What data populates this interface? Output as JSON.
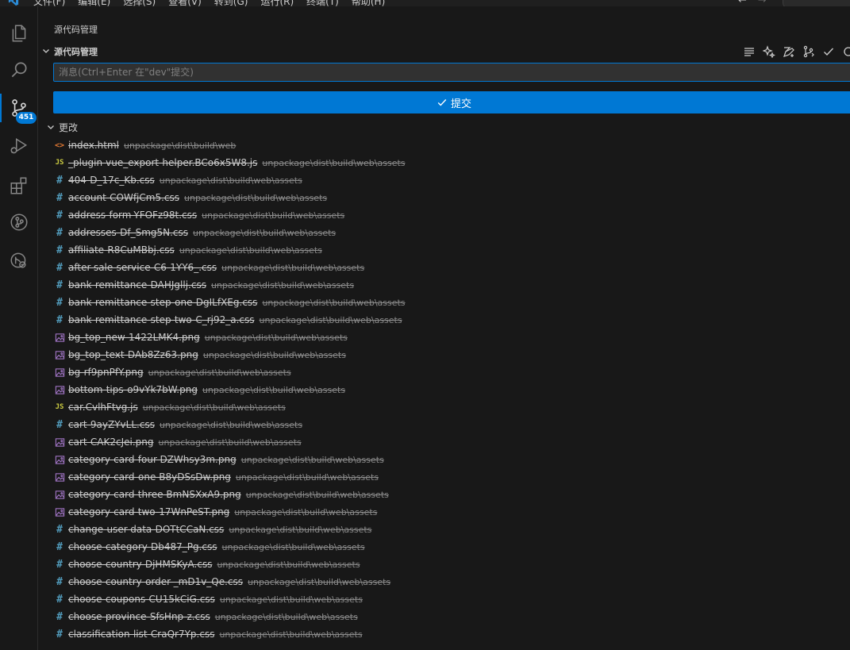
{
  "menubar": {
    "items": [
      "文件(F)",
      "编辑(E)",
      "选择(S)",
      "查看(V)",
      "转到(G)",
      "运行(R)",
      "终端(T)",
      "帮助(H)"
    ],
    "back_arrow": "←",
    "forward_arrow": "→"
  },
  "activitybar": {
    "items": [
      {
        "icon": "explorer-icon"
      },
      {
        "icon": "search-icon"
      },
      {
        "icon": "source-control-icon",
        "badge": "451",
        "active": true
      },
      {
        "icon": "run-debug-icon"
      },
      {
        "icon": "extensions-icon"
      },
      {
        "icon": "git-graph-icon"
      },
      {
        "icon": "remote-explorer-icon"
      }
    ]
  },
  "sidebar": {
    "panel_title": "源代码管理",
    "section_title": "源代码管理",
    "toolbar_icons": [
      "view-as-list-icon",
      "sparkle-icon",
      "commit-pencil-icon",
      "branch-icon",
      "check-icon",
      "refresh-icon"
    ],
    "message_placeholder": "消息(Ctrl+Enter 在\"dev\"提交)",
    "message_value": "",
    "commit_label": "提交",
    "changes_label": "更改"
  },
  "files": [
    {
      "name": "index.html",
      "path": "unpackage\\dist\\build\\web",
      "type": "html"
    },
    {
      "name": "_plugin-vue_export-helper.BCo6x5W8.js",
      "path": "unpackage\\dist\\build\\web\\assets",
      "type": "js"
    },
    {
      "name": "404-D_17c_Kb.css",
      "path": "unpackage\\dist\\build\\web\\assets",
      "type": "css"
    },
    {
      "name": "account-COWfjCm5.css",
      "path": "unpackage\\dist\\build\\web\\assets",
      "type": "css"
    },
    {
      "name": "address-form-YFOFz98t.css",
      "path": "unpackage\\dist\\build\\web\\assets",
      "type": "css"
    },
    {
      "name": "addresses-Df_Smg5N.css",
      "path": "unpackage\\dist\\build\\web\\assets",
      "type": "css"
    },
    {
      "name": "affiliate-R8CuMBbj.css",
      "path": "unpackage\\dist\\build\\web\\assets",
      "type": "css"
    },
    {
      "name": "after-sale-service-C6-1YY6_.css",
      "path": "unpackage\\dist\\build\\web\\assets",
      "type": "css"
    },
    {
      "name": "bank-remittance-DAHJgllj.css",
      "path": "unpackage\\dist\\build\\web\\assets",
      "type": "css"
    },
    {
      "name": "bank-remittance-step-one-DgILfXEg.css",
      "path": "unpackage\\dist\\build\\web\\assets",
      "type": "css"
    },
    {
      "name": "bank-remittance-step-two-C_rj92_a.css",
      "path": "unpackage\\dist\\build\\web\\assets",
      "type": "css"
    },
    {
      "name": "bg_top_new-1422LMK4.png",
      "path": "unpackage\\dist\\build\\web\\assets",
      "type": "img"
    },
    {
      "name": "bg_top_text-DAb8Zz63.png",
      "path": "unpackage\\dist\\build\\web\\assets",
      "type": "img"
    },
    {
      "name": "bg-rf9pnPfY.png",
      "path": "unpackage\\dist\\build\\web\\assets",
      "type": "img"
    },
    {
      "name": "bottom-tips-o9vYk7bW.png",
      "path": "unpackage\\dist\\build\\web\\assets",
      "type": "img"
    },
    {
      "name": "car.CvlhFtvg.js",
      "path": "unpackage\\dist\\build\\web\\assets",
      "type": "js"
    },
    {
      "name": "cart-9ayZYvLL.css",
      "path": "unpackage\\dist\\build\\web\\assets",
      "type": "css"
    },
    {
      "name": "cart-CAK2cJei.png",
      "path": "unpackage\\dist\\build\\web\\assets",
      "type": "img"
    },
    {
      "name": "category-card-four-DZWhsy3m.png",
      "path": "unpackage\\dist\\build\\web\\assets",
      "type": "img"
    },
    {
      "name": "category-card-one-B8yDSsDw.png",
      "path": "unpackage\\dist\\build\\web\\assets",
      "type": "img"
    },
    {
      "name": "category-card-three-BmNSXxA9.png",
      "path": "unpackage\\dist\\build\\web\\assets",
      "type": "img"
    },
    {
      "name": "category-card-two-17WnPeST.png",
      "path": "unpackage\\dist\\build\\web\\assets",
      "type": "img"
    },
    {
      "name": "change-user-data-DOTtCCaN.css",
      "path": "unpackage\\dist\\build\\web\\assets",
      "type": "css"
    },
    {
      "name": "choose-category-Db487_Pg.css",
      "path": "unpackage\\dist\\build\\web\\assets",
      "type": "css"
    },
    {
      "name": "choose-country-DjHMSKyA.css",
      "path": "unpackage\\dist\\build\\web\\assets",
      "type": "css"
    },
    {
      "name": "choose-country-order-_mD1v_Qe.css",
      "path": "unpackage\\dist\\build\\web\\assets",
      "type": "css"
    },
    {
      "name": "choose-coupons-CU15kCiG.css",
      "path": "unpackage\\dist\\build\\web\\assets",
      "type": "css"
    },
    {
      "name": "choose-province-SfsHnp-z.css",
      "path": "unpackage\\dist\\build\\web\\assets",
      "type": "css"
    },
    {
      "name": "classification-list-CraQr7Yp.css",
      "path": "unpackage\\dist\\build\\web\\assets",
      "type": "css"
    }
  ]
}
